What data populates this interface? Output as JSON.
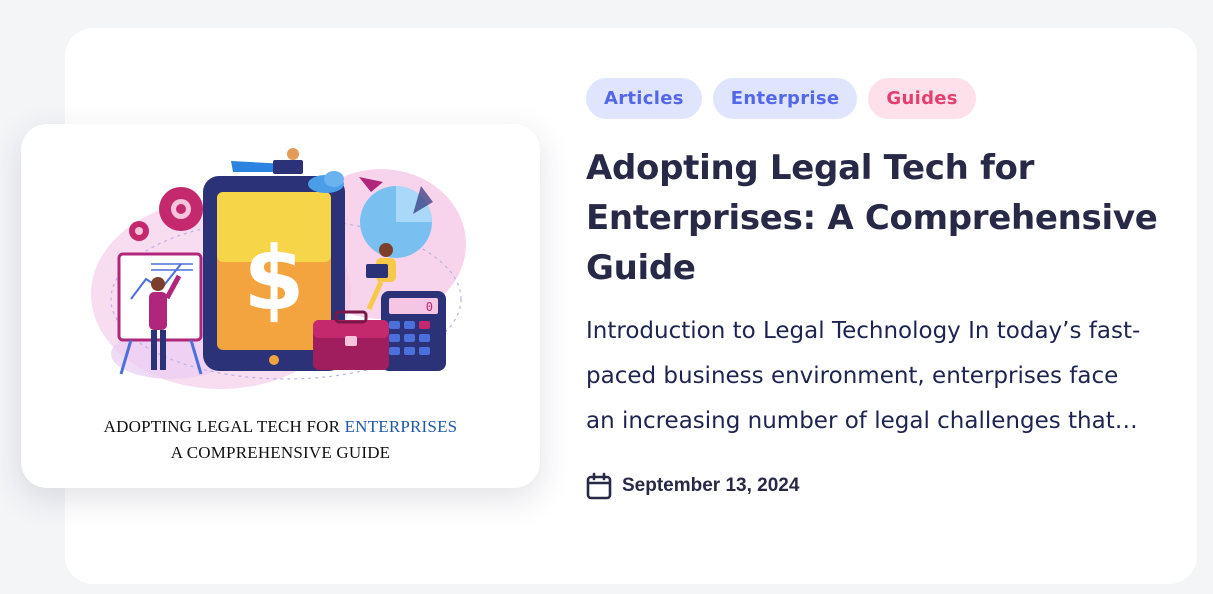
{
  "post": {
    "image": {
      "alt": "Adopting Legal Tech for Enterprises illustration",
      "caption_line1_prefix": "ADOPTING LEGAL TECH FOR ",
      "caption_line1_accent": "ENTERPRISES",
      "caption_line2": "A COMPREHENSIVE GUIDE",
      "icon": "dollar-tablet-illustration"
    },
    "tags": [
      {
        "label": "Articles",
        "color": "#5367e8",
        "bg": "#dfe5fd"
      },
      {
        "label": "Enterprise",
        "color": "#5367e8",
        "bg": "#dfe5fd"
      },
      {
        "label": "Guides",
        "color": "#e2406f",
        "bg": "#fde0ea"
      }
    ],
    "title": "Adopting Legal Tech for Enterprises: A Comprehensive Guide",
    "excerpt": "Introduction to Legal Technology In today’s fast-paced business environment, enterprises face an increasing number of legal challenges that…",
    "date": "September 13, 2024",
    "date_icon": "calendar-icon"
  },
  "colors": {
    "page_bg": "#f4f5f7",
    "card_bg": "#ffffff",
    "title": "#282847",
    "text": "#1e2450",
    "caption_accent": "#1e5aa8"
  }
}
